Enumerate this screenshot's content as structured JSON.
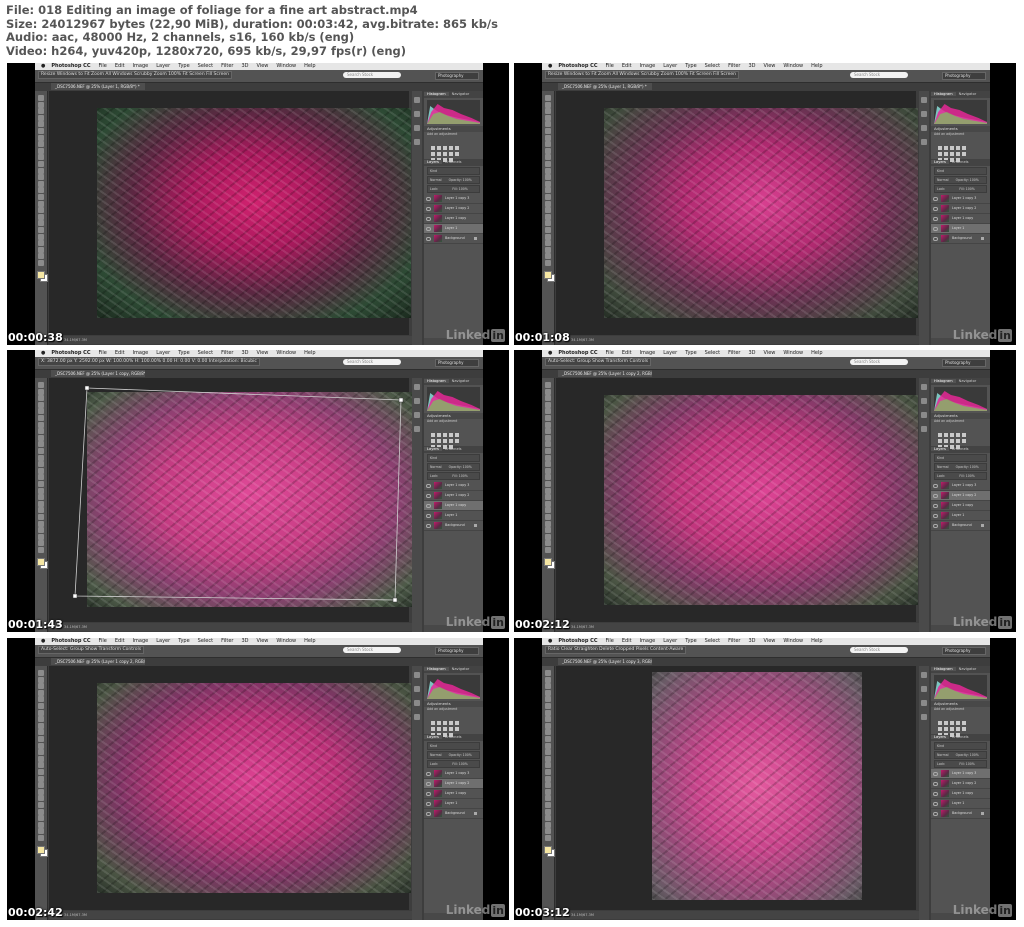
{
  "header": {
    "line1": "File: 018 Editing an image of foliage for a fine art abstract.mp4",
    "line2": "Size: 24012967 bytes (22,90 MiB), duration: 00:03:42, avg.bitrate: 865 kb/s",
    "line3": "Audio: aac, 48000 Hz, 2 channels, s16, 160 kb/s (eng)",
    "line4": "Video: h264, yuv420p, 1280x720, 695 kb/s, 29,97 fps(r) (eng)"
  },
  "app": {
    "name": "Photoshop CC",
    "menus": [
      "File",
      "Edit",
      "Image",
      "Layer",
      "Type",
      "Select",
      "Filter",
      "3D",
      "View",
      "Window",
      "Help"
    ],
    "search_placeholder": "Search Stock",
    "workspace": "Photography"
  },
  "panels": {
    "histogram_tab": "Histogram",
    "navigator_tab": "Navigator",
    "adjustments_title": "Adjustments",
    "adjustments_hint": "Add an adjustment",
    "layers_tab": "Layers",
    "channels_tab": "Channels",
    "kind_label": "Kind",
    "blend_mode": "Normal",
    "opacity_label": "Opacity: 100%",
    "lock_label": "Lock:",
    "fill_label": "Fill: 100%"
  },
  "brand": {
    "linked": "Linked",
    "in": "in"
  },
  "thumbnails": [
    {
      "timestamp": "00:00:38",
      "doc_tab": "_DSC7506.NEF @ 25% (Layer 1, RGB/8*) *",
      "options": "Resize Windows to Fit   Zoom All Windows   Scrubby Zoom   100%   Fit Screen   Fill Screen",
      "status": "Doc: 34.1M/67.3M",
      "layers": [
        {
          "name": "Layer 1 copy 3",
          "selected": false
        },
        {
          "name": "Layer 1 copy 2",
          "selected": false
        },
        {
          "name": "Layer 1 copy",
          "selected": false
        },
        {
          "name": "Layer 1",
          "selected": true
        },
        {
          "name": "Background",
          "selected": false
        }
      ]
    },
    {
      "timestamp": "00:01:08",
      "doc_tab": "_DSC7506.NEF @ 25% (Layer 1, RGB/8*) *",
      "options": "Resize Windows to Fit   Zoom All Windows   Scrubby Zoom   100%   Fit Screen   Fill Screen",
      "status": "Doc: 34.1M/67.3M",
      "layers": [
        {
          "name": "Layer 1 copy 3",
          "selected": false
        },
        {
          "name": "Layer 1 copy 2",
          "selected": false
        },
        {
          "name": "Layer 1 copy",
          "selected": false
        },
        {
          "name": "Layer 1",
          "selected": true
        },
        {
          "name": "Background",
          "selected": false
        }
      ]
    },
    {
      "timestamp": "00:01:43",
      "doc_tab": "_DSC7506.NEF @ 25% (Layer 1 copy, RGB/8*) *",
      "options": "X: 3872.00 px   Y: 2592.00 px   W: 100.00%   H: 100.00%   0.00   H: 0.00   V: 0.00   Interpolation: Bicubic",
      "status": "Doc: 34.1M/67.3M",
      "layers": [
        {
          "name": "Layer 1 copy 3",
          "selected": false
        },
        {
          "name": "Layer 1 copy 2",
          "selected": false
        },
        {
          "name": "Layer 1 copy",
          "selected": true
        },
        {
          "name": "Layer 1",
          "selected": false
        },
        {
          "name": "Background",
          "selected": false
        }
      ]
    },
    {
      "timestamp": "00:02:12",
      "doc_tab": "_DSC7506.NEF @ 25% (Layer 1 copy 2, RGB/8*) *",
      "options": "Auto-Select:   Group   Show Transform Controls",
      "status": "Doc: 34.1M/67.3M",
      "layers": [
        {
          "name": "Layer 1 copy 3",
          "selected": false
        },
        {
          "name": "Layer 1 copy 2",
          "selected": true
        },
        {
          "name": "Layer 1 copy",
          "selected": false
        },
        {
          "name": "Layer 1",
          "selected": false
        },
        {
          "name": "Background",
          "selected": false
        }
      ]
    },
    {
      "timestamp": "00:02:42",
      "doc_tab": "_DSC7506.NEF @ 25% (Layer 1 copy 2, RGB/8*) *",
      "options": "Auto-Select:   Group   Show Transform Controls",
      "status": "Doc: 34.1M/67.3M",
      "layers": [
        {
          "name": "Layer 1 copy 3",
          "selected": false
        },
        {
          "name": "Layer 1 copy 2",
          "selected": true
        },
        {
          "name": "Layer 1 copy",
          "selected": false
        },
        {
          "name": "Layer 1",
          "selected": false
        },
        {
          "name": "Background",
          "selected": false
        }
      ]
    },
    {
      "timestamp": "00:03:12",
      "doc_tab": "_DSC7506.NEF @ 25% (Layer 1 copy 3, RGB/8*) *",
      "options": "Ratio   Clear   Straighten   Delete Cropped Pixels   Content-Aware",
      "status": "Doc: 34.1M/67.3M",
      "layers": [
        {
          "name": "Layer 1 copy 3",
          "selected": true
        },
        {
          "name": "Layer 1 copy 2",
          "selected": false
        },
        {
          "name": "Layer 1 copy",
          "selected": false
        },
        {
          "name": "Layer 1",
          "selected": false
        },
        {
          "name": "Background",
          "selected": false
        }
      ]
    }
  ]
}
